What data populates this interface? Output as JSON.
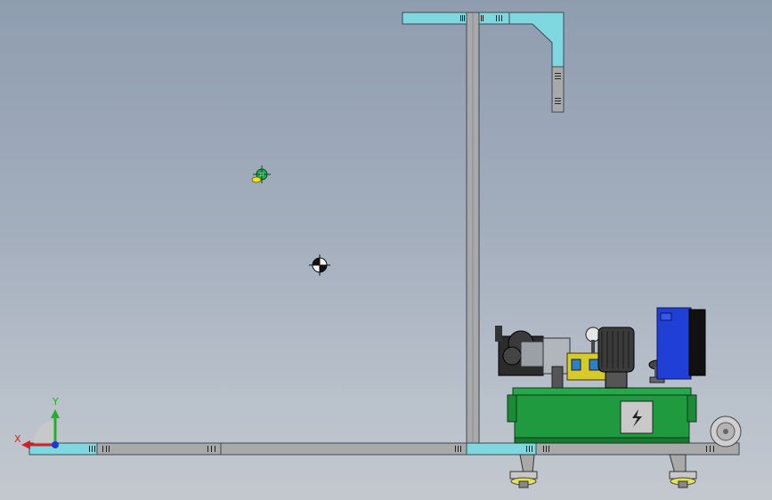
{
  "viewport": {
    "triad": {
      "x_label": "X",
      "y_label": "Y"
    }
  },
  "colors": {
    "frame_gray": "#a9a9a9",
    "frame_cyan": "#7fd8df",
    "tank_green": "#1f9a3f",
    "motor_blue": "#1f3fd6",
    "axis_red": "#d52020",
    "axis_green": "#21b02b",
    "axis_blue": "#2036d8"
  },
  "icons": {
    "coordinate_triad": "xyz-triad-icon",
    "center_of_mass": "center-of-mass-icon",
    "origin_marker": "origin-icon",
    "high_voltage": "lightning-icon"
  }
}
